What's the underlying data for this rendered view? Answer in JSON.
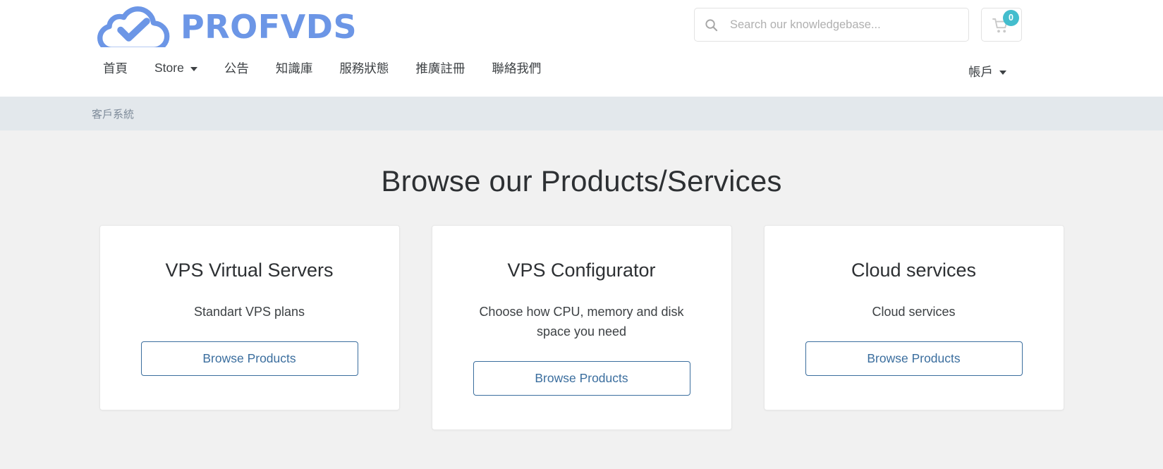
{
  "brand": {
    "word": "PROFVDS",
    "logo_color": "#6c96e6",
    "icon": "cloud-check-icon"
  },
  "search": {
    "placeholder": "Search our knowledgebase...",
    "value": "",
    "icon": "search-icon"
  },
  "cart": {
    "icon": "shopping-cart-icon",
    "count": "0",
    "badge_color": "#43bdcd"
  },
  "nav": {
    "items": [
      {
        "label": "首頁",
        "has_caret": false
      },
      {
        "label": "Store",
        "has_caret": true
      },
      {
        "label": "公告",
        "has_caret": false
      },
      {
        "label": "知識庫",
        "has_caret": false
      },
      {
        "label": "服務狀態",
        "has_caret": false
      },
      {
        "label": "推廣註冊",
        "has_caret": false
      },
      {
        "label": "聯絡我們",
        "has_caret": false
      }
    ],
    "account": {
      "label": "帳戶",
      "has_caret": true
    }
  },
  "breadcrumb": {
    "text": "客戶系統"
  },
  "main": {
    "title": "Browse our Products/Services",
    "cards": [
      {
        "title": "VPS Virtual Servers",
        "description": "Standart VPS plans",
        "button_label": "Browse Products"
      },
      {
        "title": "VPS Configurator",
        "description": "Choose how CPU, memory and disk space you need",
        "button_label": "Browse Products"
      },
      {
        "title": "Cloud services",
        "description": "Cloud services",
        "button_label": "Browse Products"
      }
    ]
  },
  "colors": {
    "accent_blue": "#6c96e6",
    "button_blue": "#3b6e9e",
    "breadcrumb_bg": "#e3e8ec",
    "page_bg": "#f1f1f1",
    "badge_teal": "#43bdcd"
  }
}
